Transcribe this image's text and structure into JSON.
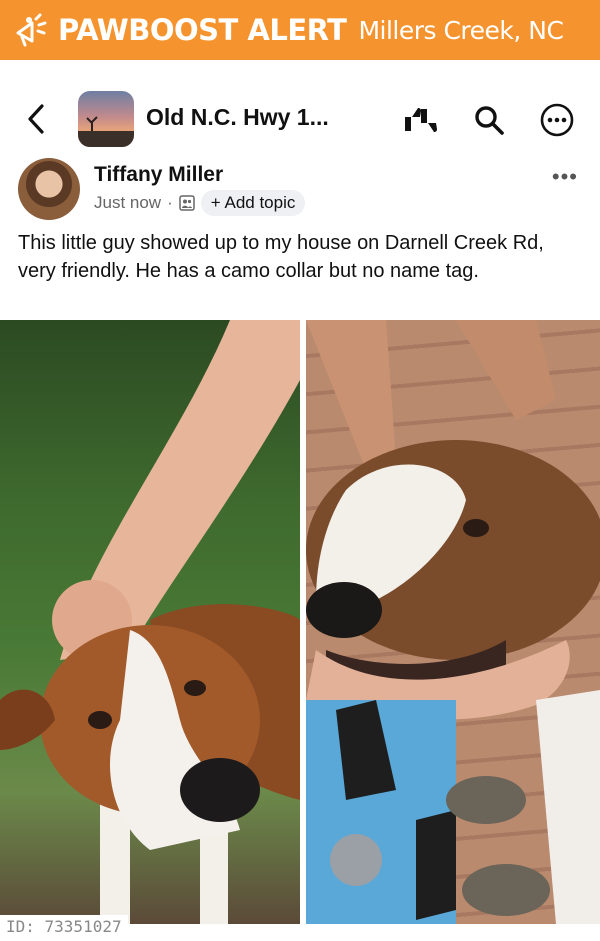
{
  "alert": {
    "title": "PAWBOOST ALERT",
    "location": "Millers Creek, NC",
    "icon": "megaphone-icon",
    "color": "#f5942e"
  },
  "nav": {
    "group_name": "Old N.C. Hwy 1...",
    "icons": [
      "back-chevron-icon",
      "thumbs-icon",
      "search-icon",
      "more-circle-icon"
    ]
  },
  "post": {
    "author": "Tiffany Miller",
    "timestamp": "Just now",
    "separator": "·",
    "topic_button": "+ Add topic",
    "text": "This little guy showed up to my house on Darnell Creek Rd, very friendly. He has a camo collar but no name tag.",
    "more": "•••"
  },
  "footer": {
    "id_label": "ID: 73351027"
  }
}
